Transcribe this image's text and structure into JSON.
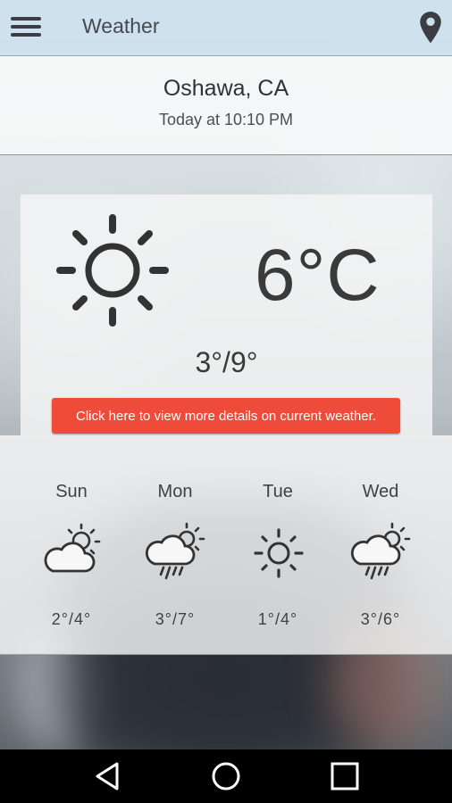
{
  "appbar": {
    "title": "Weather",
    "menu_icon": "hamburger-menu-icon",
    "location_icon": "location-pin-icon"
  },
  "location": {
    "city": "Oshawa, CA",
    "updated": "Today at 10:10 PM"
  },
  "current": {
    "icon": "sun-icon",
    "temperature": "6°C",
    "range": "3°/9°",
    "details_button": "Click here to view more details on current weather."
  },
  "forecast": [
    {
      "day": "Sun",
      "icon": "partly-cloudy-icon",
      "range": "2°/4°"
    },
    {
      "day": "Mon",
      "icon": "rain-sun-icon",
      "range": "3°/7°"
    },
    {
      "day": "Tue",
      "icon": "sun-icon",
      "range": "1°/4°"
    },
    {
      "day": "Wed",
      "icon": "rain-sun-icon",
      "range": "3°/6°"
    }
  ],
  "navbar": {
    "back_icon": "back-triangle-icon",
    "home_icon": "home-circle-icon",
    "recents_icon": "recents-square-icon"
  },
  "colors": {
    "accent": "#ef4b3a",
    "text": "#3a3a3a",
    "appbar": "#cbe0ec"
  }
}
